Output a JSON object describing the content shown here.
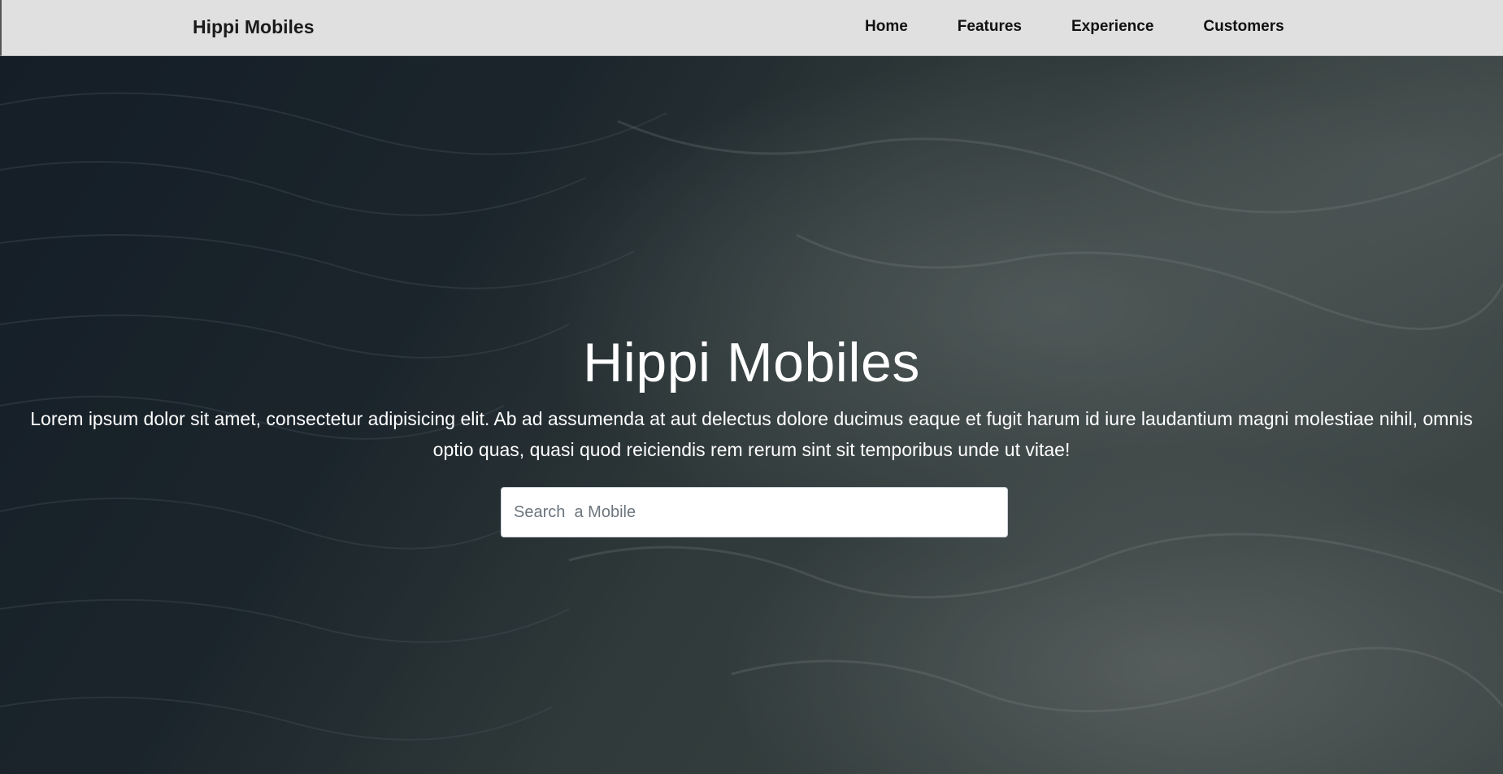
{
  "nav": {
    "brand": "Hippi Mobiles",
    "links": [
      "Home",
      "Features",
      "Experience",
      "Customers"
    ]
  },
  "hero": {
    "title": "Hippi Mobiles",
    "description": "Lorem ipsum dolor sit amet, consectetur adipisicing elit. Ab ad assumenda at aut delectus dolore ducimus eaque et fugit harum id iure laudantium magni molestiae nihil, omnis optio quas, quasi quod reiciendis rem rerum sint sit temporibus unde ut vitae!",
    "search_placeholder": "Search  a Mobile"
  },
  "colors": {
    "navbar_bg": "#e0e0e0",
    "hero_overlay": "#1d2730",
    "hero_text": "#ffffff"
  }
}
